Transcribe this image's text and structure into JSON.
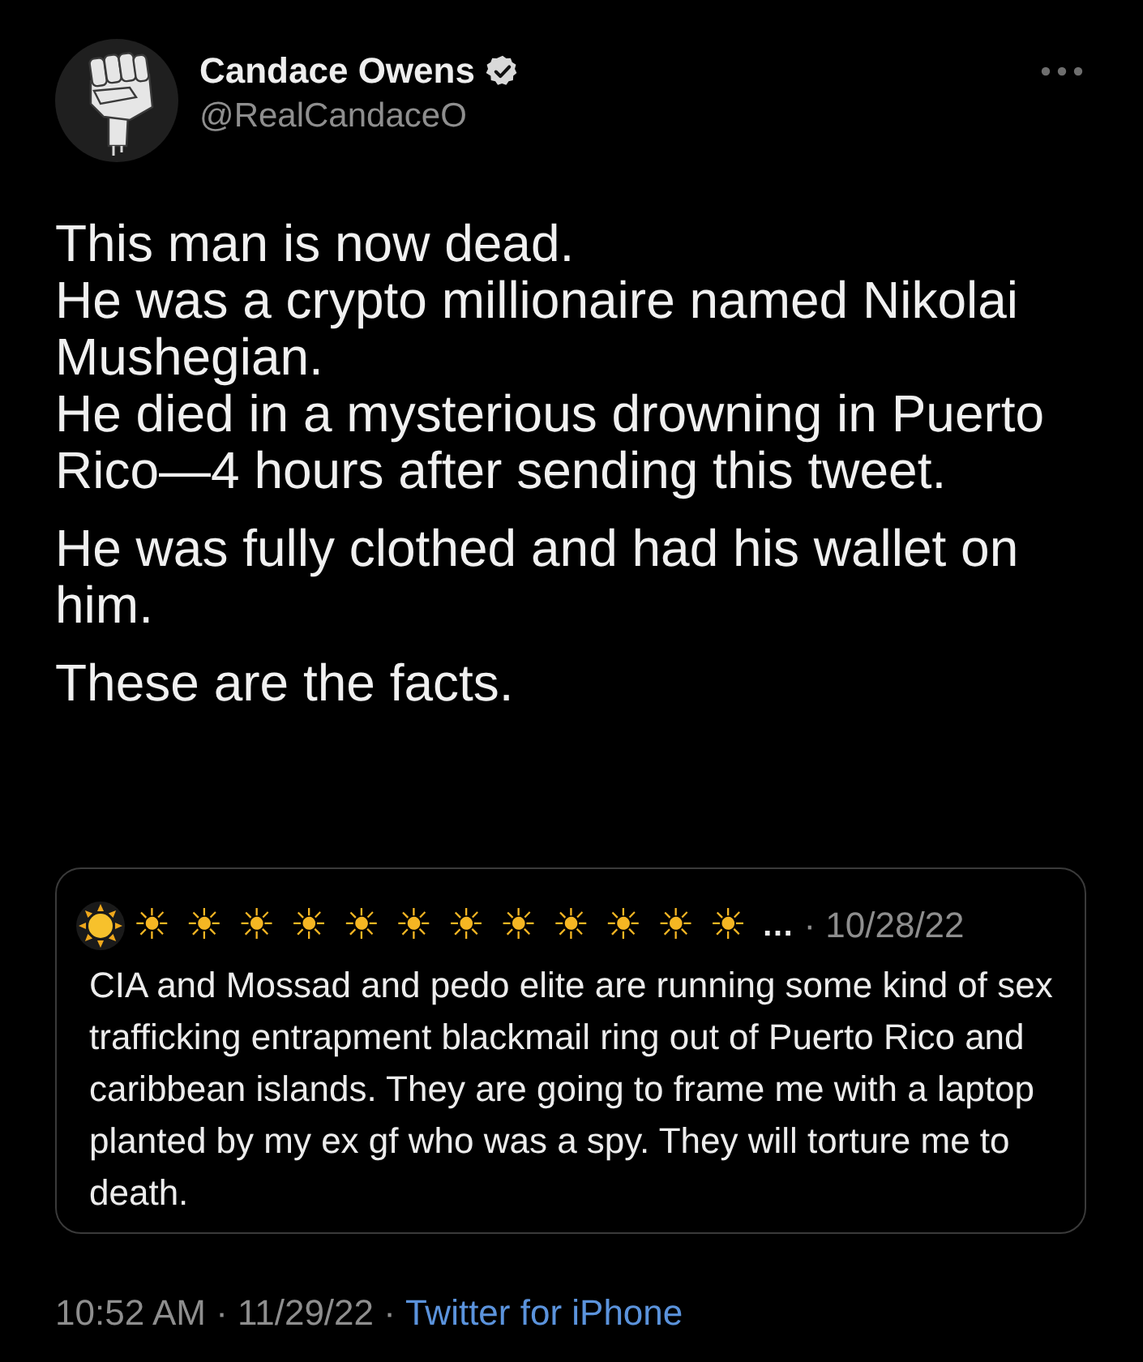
{
  "tweet": {
    "author": {
      "name": "Candace Owens",
      "handle": "@RealCandaceO",
      "verified": true
    },
    "body": [
      "This man is now dead.\nHe was a crypto millionaire named Nikolai Mushegian.\nHe died in a mysterious drowning in Puerto Rico—4 hours after sending this tweet.",
      "He was fully clothed and had his wallet on him.",
      "These are the facts."
    ],
    "quoted_tweet": {
      "author_name": "☀☀☀☀☀☀☀☀☀☀☀☀",
      "name_ellipsis": "…",
      "date": "· 10/28/22",
      "text": "CIA and Mossad and pedo elite are running some kind of sex trafficking entrapment blackmail ring out of Puerto Rico and caribbean islands. They are going to frame me with a laptop planted by my ex gf who was a spy. They will torture me to death."
    },
    "footer": {
      "meta": "10:52 AM · 11/29/22 ·",
      "source": "Twitter for iPhone"
    }
  }
}
